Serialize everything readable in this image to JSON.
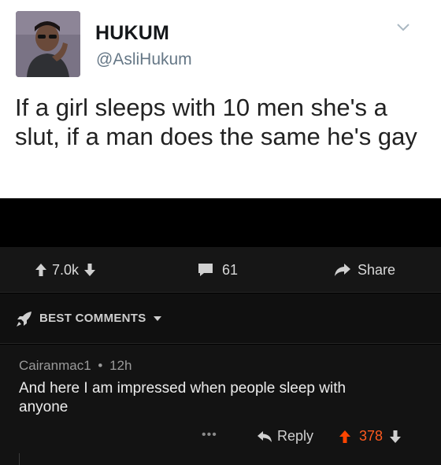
{
  "tweet": {
    "display_name": "HUKUM",
    "handle": "@AsliHukum",
    "text": "If a girl sleeps with 10 men she's a slut, if a man does the same he's gay",
    "avatar_icon": "profile-photo",
    "menu_icon": "chevron-down-icon"
  },
  "post_actions": {
    "score": "7.0k",
    "comments": "61",
    "share_label": "Share"
  },
  "sort": {
    "label": "BEST COMMENTS",
    "icon": "rocket-icon"
  },
  "comment": {
    "author": "Cairanmac1",
    "separator": "•",
    "age": "12h",
    "body": "And here I am impressed when people sleep with anyone",
    "more_label": "•••",
    "reply_label": "Reply",
    "score": "378"
  },
  "colors": {
    "upvote": "#ff4500",
    "tweet_bg": "#ffffff",
    "app_bg": "#161616"
  }
}
